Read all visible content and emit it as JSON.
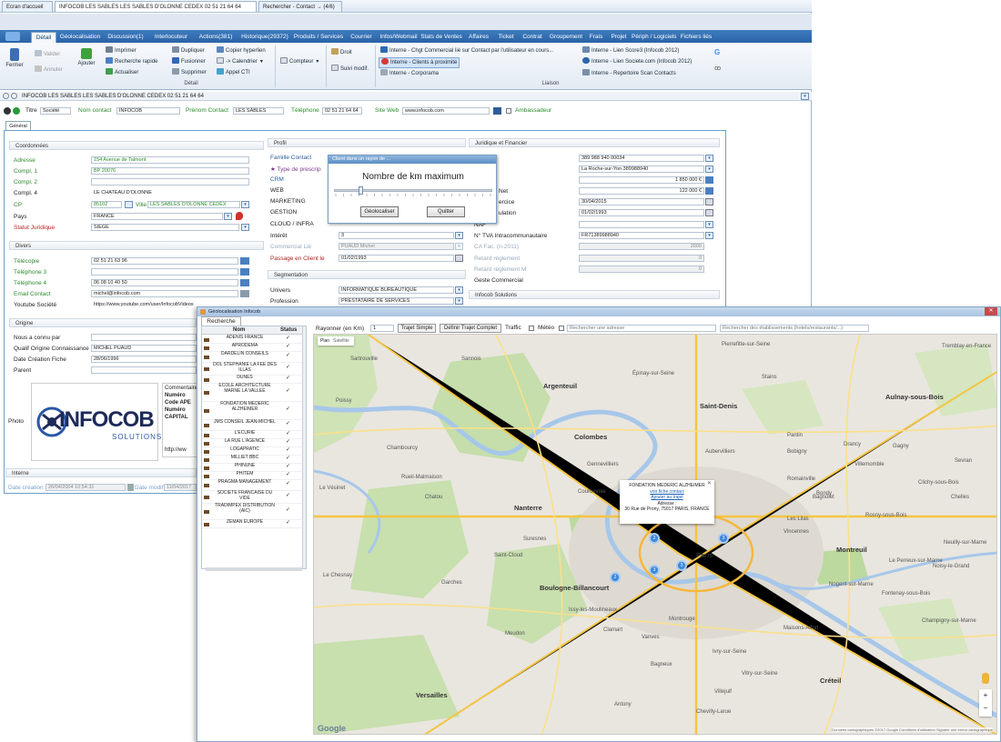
{
  "window_tabs": [
    "Ecran d'accueil",
    "INFOCOB LES SABLES LES SABLES D'OLONNE CEDEX 02 51 21 64 64",
    "Rechercher - Contact → (4/6)"
  ],
  "ribbon_tabs": [
    "Détail",
    "Géolocalisation",
    "Discussion(1)",
    "Interlocuteur",
    "Actions(381)",
    "Historique(29372)",
    "Produits / Services",
    "Courrier",
    "Infos/Webmail",
    "Stats de Ventes",
    "Affaires",
    "Ticket",
    "Contrat",
    "Groupement",
    "Frais",
    "Projet",
    "Périph / Logiciels",
    "Fichiers liés"
  ],
  "ribbon": {
    "fermer": "Fermer",
    "valider": "Valider",
    "annuler": "Annuler",
    "ajouter": "Ajouter",
    "imprimer": "Imprimer",
    "recherche_rapide": "Recherche rapide",
    "actualiser": "Actualiser",
    "dupliquer": "Dupliquer",
    "fusionner": "Fusionner",
    "supprimer": "Supprimer",
    "copier_hyperlien": "Copier hyperlien",
    "calendrier": "-> Calendrier",
    "appel_cti": "Appel CTI",
    "compteur": "Compteur",
    "droit": "Droit",
    "suivi_modif": "Suivi modif.",
    "group_detail": "Détail",
    "group_liaison": "Liaison",
    "liaison1": "Interne - Chgt Commercial lié sur Contact  par l'utilisateur en cours...",
    "liaison2": "Interne - Clients à proximité",
    "liaison3": "Interne - Corporama",
    "liaison4": "Interne - Lien Score3 (Infocob 2012)",
    "liaison5": "Interne - Lien Societe.com (Infocob 2012)",
    "liaison6": "Interne - Repertoire Scan Contacts"
  },
  "address_bar": "INFOCOB LES SABLES LES SABLES D'OLONNE CEDEX 02 51 21 64 64",
  "header_row": {
    "titre": "Titre",
    "titre_val": "Société",
    "nom_contact": "Nom contact",
    "nom_val": "INFOCOB",
    "prenom": "Prénom Contact",
    "prenom_val": "LES SABLES",
    "telephone": "Téléphone",
    "tel_val": "02 51 21 64 64",
    "site_web": "Site Web",
    "site_val": "www.infocob.com",
    "ambassadeur": "Ambassadeur"
  },
  "general_tab": "Général",
  "coord": {
    "title": "Coordonnées",
    "adresse": "Adresse",
    "adresse_val": "154 Avenue de Talmont",
    "compl1": "Compl. 1",
    "compl1_val": "BP 20076",
    "compl2": "Compl. 2",
    "compl4": "Compl. 4",
    "compl4_val": "LE CHATEAU D'OLONNE",
    "cp": "CP",
    "cp_val": "85102",
    "ville": "Ville",
    "ville_val": "LES SABLES D'OLONNE CEDEX",
    "pays": "Pays",
    "pays_val": "FRANCE",
    "statut": "Statut Juridique",
    "statut_val": "SIEGE"
  },
  "divers": {
    "title": "Divers",
    "telecopie": "Télécopie",
    "telecopie_val": "02 51 21 63 96",
    "tel3": "Téléphone 3",
    "tel4": "Téléphone 4",
    "tel4_val": "06 08 10 40 50",
    "email": "Email Contact",
    "email_val": "michel@infocob.com",
    "youtube": "Youtube Société",
    "youtube_val": "https://www.youtube.com/user/InfocobVideos"
  },
  "origine": {
    "title": "Origine",
    "nous": "Nous a connu par",
    "qualif": "Qualif Origine Connaissance",
    "qualif_val": "MICHEL PUAUD",
    "date_creation": "Date Création Fiche",
    "date_val": "28/06/1996",
    "parent": "Parent",
    "photo": "Photo",
    "logo_text": "INFOCOB",
    "logo_sub": "SOLUTIONS",
    "commentaire": "Commentaire",
    "comm_lines": [
      "Numéro",
      "Code APE",
      "Numéro",
      "CAPITAL"
    ],
    "comm_url": "http://ww"
  },
  "interne": {
    "title": "Interne",
    "date_creation": "Date création",
    "date_creation_val": "26/04/2004 10:54:31",
    "date_modif": "Date modif",
    "date_modif_val": "11/04/2017"
  },
  "profil": {
    "title": "Profil",
    "famille": "Famille Contact",
    "type": "Type de prescrip",
    "crm": "CRM",
    "web": "WEB",
    "marketing": "MARKETING",
    "gestion": "GESTION",
    "cloud": "CLOUD / INFRA",
    "interet": "Intérêt",
    "interet_val": "3",
    "commercial": "Commercial Lié",
    "commercial_val": "PUAUD Michel",
    "passage": "Passage en Client le",
    "passage_val": "01/02/1993",
    "segmentation": "Segmentation",
    "univers": "Univers",
    "univers_val": "INFORMATIQUE BUREAUTIQUE",
    "profession": "Profession",
    "profession_val": "PRESTATAIRE DE SERVICES"
  },
  "juridique": {
    "title": "Juridique et Financier",
    "siret_val": "389 988 940 00034",
    "rcs_val": "La Roche-sur-Yon 389988940",
    "ca_val": "1 850 000 €",
    "net": "Net",
    "net_val": "122 000 €",
    "exercice": "ercice",
    "exercice_val": "30/04/2015",
    "creation": "ulation",
    "creation_val": "01/02/1993",
    "naf": "NAF",
    "tva": "N° TVA Intracommunautaire",
    "tva_val": "FR71389988940",
    "cafac": "CA Fac. (n-2011)",
    "cafac_val": "2000",
    "retard": "Retard règlement",
    "retard_val": "0",
    "retard_m1": "Retard règlement M",
    "retard_m1_val": "0",
    "geste": "Geste Commercial",
    "solutions": "Infocob Solutions"
  },
  "popup": {
    "title": "Client dans un rayon de ...",
    "heading": "Nombre de km maximum",
    "slider_level": 0.15,
    "geolocaliser": "Géolocaliser",
    "quitter": "Quitter"
  },
  "geo": {
    "title": "Géolocalisation Infocob",
    "tab": "Recherche",
    "col_nom": "Nom",
    "col_status": "Status",
    "rows": [
      "ADENIS FRANCE",
      "APRODEMA",
      "DARDELIN CONSEILS",
      "DOL STEPHANIE LA FEE DES ILLAS",
      "DUNES",
      "ECOLE ARCHITECTURE MARNE LA VALLEE",
      "FONDATION MEDERIC ALZHEIMER",
      "JMS CONSEIL JEAN-MICHEL",
      "L'ECURIE",
      "LA RUE L'AGENCE",
      "LOGAPRATIC",
      "MILLIET BBC",
      "PHINUNE",
      "PHITEM",
      "PRAGMA MANAGEMENT",
      "SOCIETE FRANCAISE DU VIDE",
      "TRADIMPEX DISTRIBUTION (AIC)",
      "ZEMAN EUROPE"
    ],
    "check": "✓",
    "rayonner": "Rayonner (en Km)",
    "rayonner_val": "1",
    "trajet_simple": "Trajet Simple",
    "trajet_complet": "Définir Trajet Complet",
    "traffic": "Traffic",
    "meteo": "Météo",
    "recherche_adresse": "Rechercher une adresse",
    "recherche_etab": "Rechercher des établissements (hotels/restaurants/...)",
    "plan": "Plan",
    "satellite": "Satellite",
    "info_name": "FONDATION MEDERIC ALZHEIMER",
    "info_voir": "voir fiche contact",
    "info_ajout": "Ajouter au trajet",
    "info_adresse": "Adresse :",
    "info_addr": "30 Rue de Prony, 75017 PARIS, FRANCE",
    "attribution": "Données cartographiques ©2017 Google   Conditions d'utilisation   Signaler une erreur cartographique",
    "google": "Google",
    "map_labels": [
      "Argenteuil",
      "Saint-Denis",
      "Aulnay-sous-Bois",
      "Colombes",
      "Nanterre",
      "Paris",
      "Montreuil",
      "Boulogne-Billancourt",
      "Versailles",
      "Créteil",
      "Rueil-Malmaison",
      "Chatou",
      "Poissy",
      "Sannois",
      "Drancy",
      "Bobigny",
      "Vincennes",
      "Vitry-sur-Seine",
      "Clichy-sous-Bois",
      "Noisy-le-Grand",
      "Antony",
      "Fontenay-sous-Bois",
      "Champigny-sur-Marne",
      "Suresnes",
      "Pantin",
      "Courbevoie",
      "Épinay-sur-Seine",
      "Sartrouville",
      "Le Vésinet",
      "Chambourcy",
      "Meudon",
      "Clamart",
      "Issy-les-Moulineaux",
      "Gennevilliers",
      "Bondy",
      "Rosny-sous-Bois",
      "Ivry-sur-Seine",
      "Villejuif",
      "Saint-Cloud",
      "Garches",
      "Vanves",
      "Montrouge",
      "Le Chesnay",
      "Bagneux",
      "Chevilly-Larue",
      "Maisons-Alfort",
      "Nogent-sur-Marne",
      "Le Perreux-sur-Marne",
      "Les Lilas",
      "Romainville",
      "Bagnolet",
      "Aubervilliers",
      "Stains",
      "Pierrefitte-sur-Seine",
      "Sevran",
      "Villemomble",
      "Gagny",
      "Neuilly-sur-Marne",
      "Chelles",
      "Tremblay-en-France"
    ],
    "markers": [
      "2",
      "3",
      "2",
      "3",
      "3"
    ]
  }
}
